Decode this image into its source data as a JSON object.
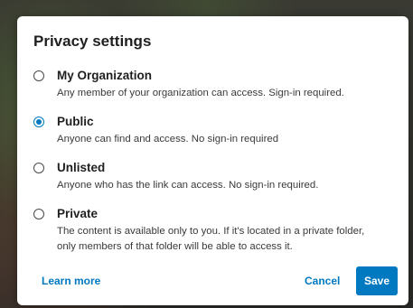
{
  "dialog": {
    "title": "Privacy settings",
    "options": [
      {
        "label": "My Organization",
        "description": "Any member of your organization can access. Sign-in required.",
        "selected": false
      },
      {
        "label": "Public",
        "description": "Anyone can find and access. No sign-in required",
        "selected": true
      },
      {
        "label": "Unlisted",
        "description": "Anyone who has the link can access. No sign-in required.",
        "selected": false
      },
      {
        "label": "Private",
        "description": "The content is available only to you. If it's located in a private folder, only members of that folder will be able to access it.",
        "selected": false
      }
    ],
    "learn_more_label": "Learn more",
    "cancel_label": "Cancel",
    "save_label": "Save"
  },
  "colors": {
    "accent": "#0079c1",
    "text": "#1f1f1f",
    "background": "#ffffff"
  },
  "icons": {
    "radio_unselected": "radio-unselected-icon",
    "radio_selected": "radio-selected-icon"
  }
}
